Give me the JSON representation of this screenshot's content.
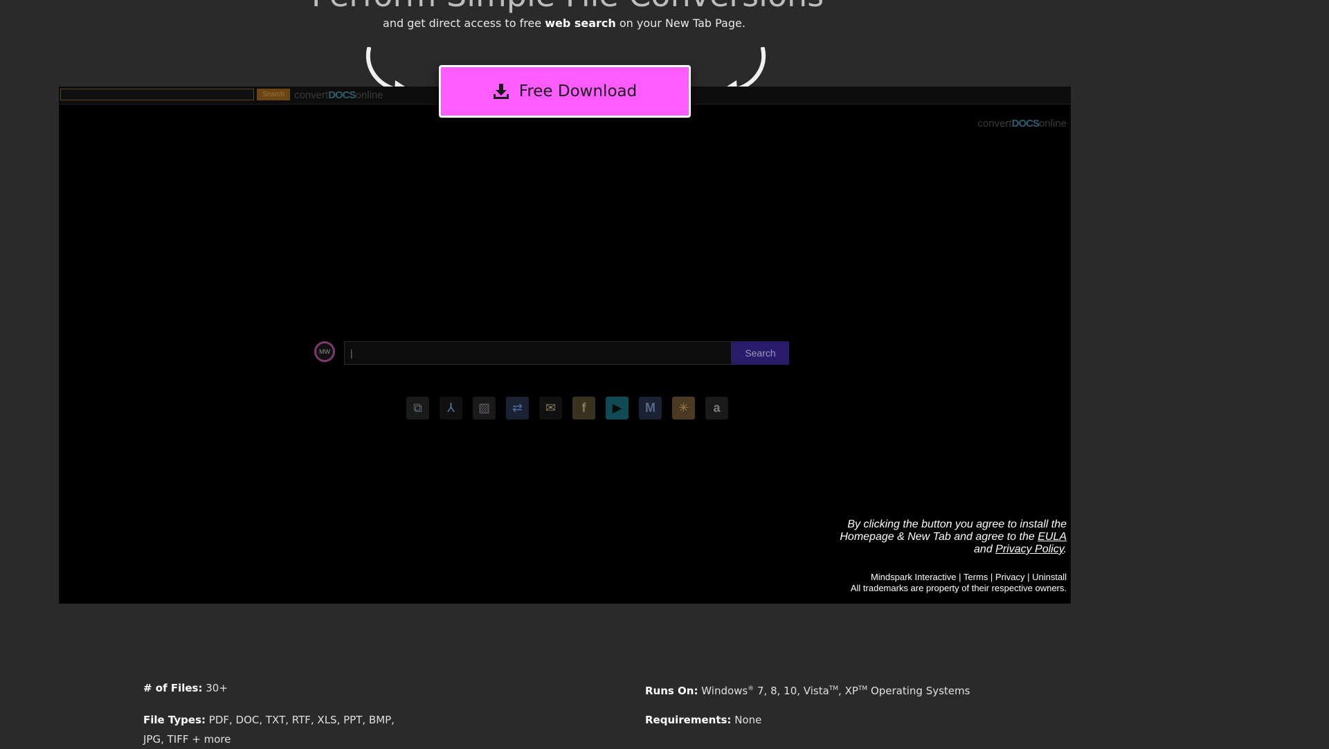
{
  "hero": {
    "headline": "Perform Simple File Conversions",
    "sub_before": "and get direct access to free ",
    "sub_bold": "web search",
    "sub_after": " on your New Tab Page.",
    "download_label": "Free Download"
  },
  "preview": {
    "toolbar_search_label": "Search",
    "logo_convert": "convert",
    "logo_docs": "DOCS",
    "logo_online": "online",
    "mw_badge": "MW",
    "search_button": "Search",
    "quick_icons": [
      "convert-icon",
      "acrobat-icon",
      "image-icon",
      "translate-icon",
      "inbox-icon",
      "facebook-icon",
      "youtube-icon",
      "gmail-icon",
      "walmart-icon",
      "amazon-icon"
    ],
    "legal_line1": "By clicking the button you agree to install the",
    "legal_line2_before": "Homepage & New Tab and agree to the ",
    "eula_link": "EULA",
    "legal_and": "and ",
    "privacy_link": "Privacy Policy",
    "legal_period": ".",
    "footer_mindspark": "Mindspark Interactive",
    "footer_terms": "Terms",
    "footer_privacy": "Privacy",
    "footer_uninstall": "Uninstall",
    "footer_sep": " | ",
    "trademarks": "All trademarks are property of their respective owners."
  },
  "specs": {
    "files_label": "# of Files:",
    "files_value": " 30+",
    "types_label": "File Types:",
    "types_value": " PDF, DOC, TXT, RTF, XLS, PPT, BMP,",
    "types_value2": "JPG, TIFF + more",
    "runs_label": "Runs On:",
    "runs_value_a": " Windows",
    "reg": "®",
    "runs_value_b": " 7, 8, 10, Vista",
    "tm": "TM",
    "runs_value_c": ", XP",
    "runs_value_d": " Operating Systems",
    "req_label": "Requirements:",
    "req_value": " None"
  },
  "colors": {
    "button": "#ff5cff",
    "page_bg": "#2a2a2a",
    "preview_bg": "#000000"
  }
}
